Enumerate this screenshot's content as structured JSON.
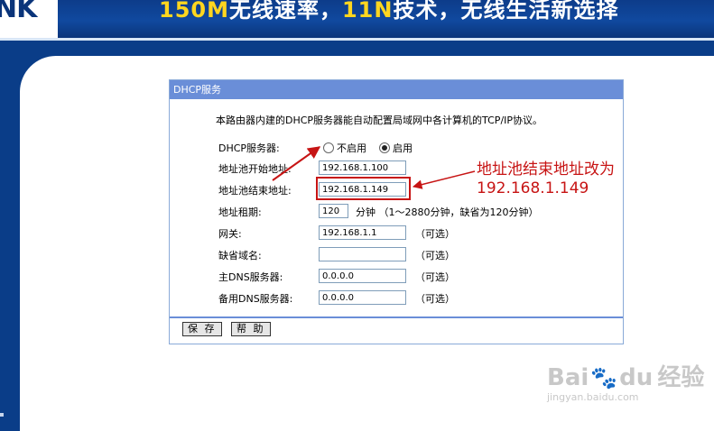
{
  "banner": {
    "logo_text": "NK",
    "slogan_part1": "150M",
    "slogan_part2": "无线速率，",
    "slogan_part3": "11N",
    "slogan_part4": "技术，无线生活新选择"
  },
  "dialog": {
    "title": "DHCP服务",
    "description": "本路由器内建的DHCP服务器能自动配置局域网中各计算机的TCP/IP协议。",
    "dhcp_server": {
      "label": "DHCP服务器:",
      "options": [
        "不启用",
        "启用"
      ],
      "selected": "启用"
    },
    "start_ip": {
      "label": "地址池开始地址:",
      "value": "192.168.1.100"
    },
    "end_ip": {
      "label": "地址池结束地址:",
      "value": "192.168.1.149"
    },
    "lease": {
      "label": "地址租期:",
      "value": "120",
      "unit_hint": "分钟 （1～2880分钟，缺省为120分钟）"
    },
    "gateway": {
      "label": "网关:",
      "value": "192.168.1.1",
      "hint": "（可选）"
    },
    "domain": {
      "label": "缺省域名:",
      "value": "",
      "hint": "（可选）"
    },
    "primary_dns": {
      "label": "主DNS服务器:",
      "value": "0.0.0.0",
      "hint": "（可选）"
    },
    "secondary_dns": {
      "label": "备用DNS服务器:",
      "value": "0.0.0.0",
      "hint": "（可选）"
    },
    "save_label": "保 存",
    "help_label": "帮 助"
  },
  "annotation": {
    "line1": "地址池结束地址改为",
    "line2": "192.168.1.149",
    "color": "#c71414"
  },
  "watermark": {
    "brand_left": "Bai",
    "brand_right": "du",
    "brand_cn": "经验",
    "url": "jingyan.baidu.com"
  },
  "colors": {
    "background": "#0a3d88",
    "title_bar": "#6a8ed8",
    "annotation": "#c71414"
  }
}
